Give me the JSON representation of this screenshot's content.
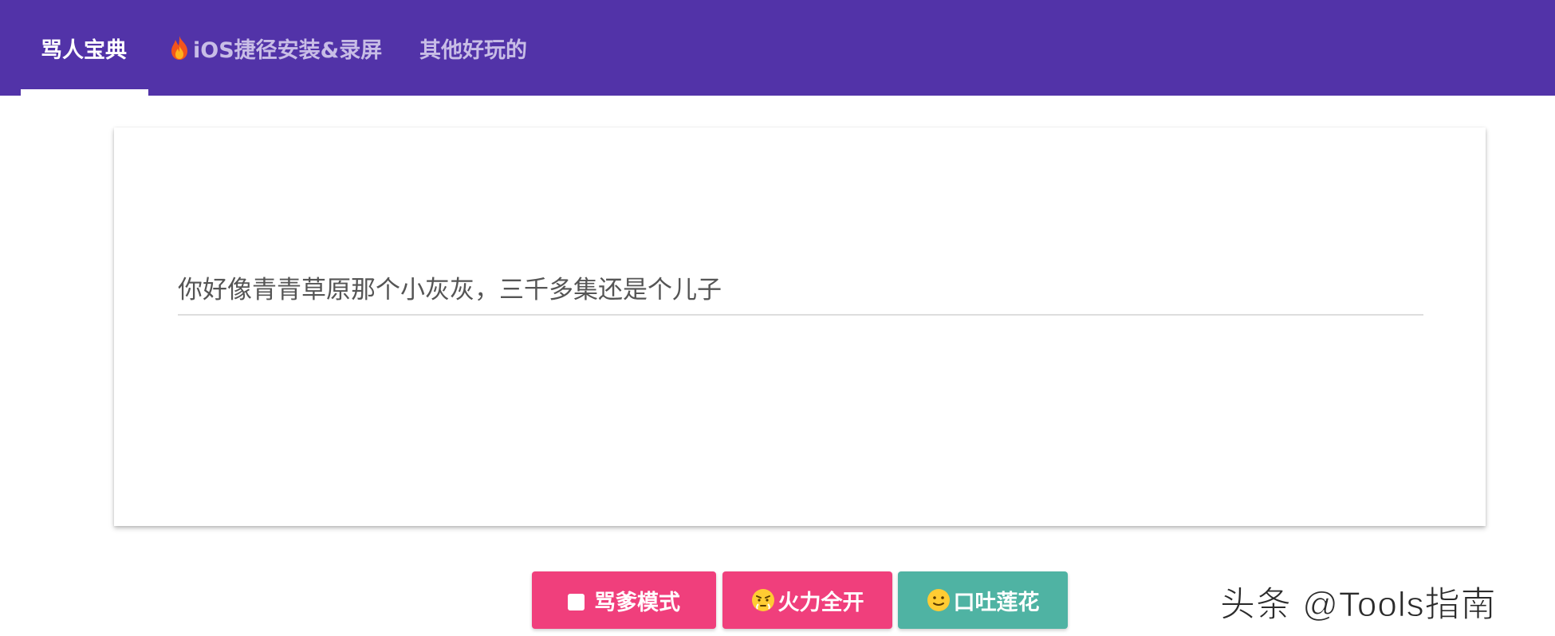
{
  "nav": {
    "tabs": [
      {
        "label": "骂人宝典",
        "active": true
      },
      {
        "label": "iOS捷径安装&录屏",
        "icon": "fire-icon"
      },
      {
        "label": "其他好玩的"
      }
    ]
  },
  "main": {
    "sentence": "你好像青青草原那个小灰灰，三千多集还是个儿子"
  },
  "actions": {
    "mode_label": "骂爹模式",
    "fire_label": "火力全开",
    "lotus_label": "口吐莲花"
  },
  "watermark": "头条 @Tools指南",
  "colors": {
    "header": "#5233a8",
    "pink": "#f03f7c",
    "teal": "#4fb3a3"
  }
}
